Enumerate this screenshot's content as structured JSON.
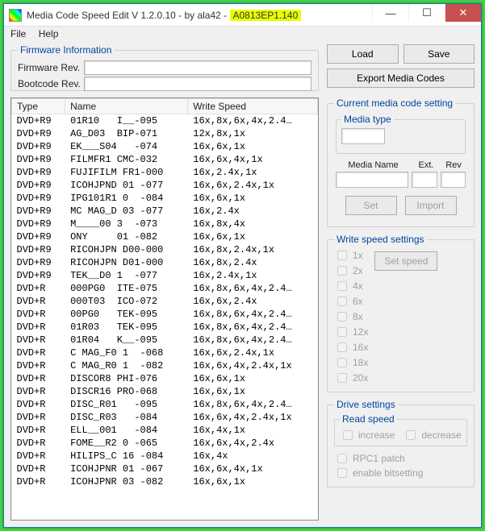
{
  "title_prefix": "Media Code Speed Edit V 1.2.0.10 - by ala42 - ",
  "title_highlight": "A0813EP1.140",
  "menu": {
    "file": "File",
    "help": "Help"
  },
  "firmware_info": {
    "legend": "Firmware Information",
    "fw_label": "Firmware Rev.",
    "fw_value": "",
    "bc_label": "Bootcode Rev.",
    "bc_value": ""
  },
  "buttons": {
    "load": "Load",
    "save": "Save",
    "export": "Export Media Codes",
    "set": "Set",
    "import": "Import",
    "set_speed": "Set speed"
  },
  "table": {
    "cols": [
      "Type",
      "Name",
      "Write Speed"
    ],
    "rows": [
      [
        "DVD+R9",
        "01R10   I__-095",
        "16x,8x,6x,4x,2.4…"
      ],
      [
        "DVD+R9",
        "AG_D03  BIP-071",
        "12x,8x,1x"
      ],
      [
        "DVD+R9",
        "EK___S04   -074",
        "16x,6x,1x"
      ],
      [
        "DVD+R9",
        "FILMFR1 CMC-032",
        "16x,6x,4x,1x"
      ],
      [
        "DVD+R9",
        "FUJIFILM FR1-000",
        "16x,2.4x,1x"
      ],
      [
        "DVD+R9",
        "ICOHJPND 01 -077",
        "16x,6x,2.4x,1x"
      ],
      [
        "DVD+R9",
        "IPG101R1 0  -084",
        "16x,6x,1x"
      ],
      [
        "DVD+R9",
        "MC MAG_D 03 -077",
        "16x,2.4x"
      ],
      [
        "DVD+R9",
        "M____00 3  -073",
        "16x,8x,4x"
      ],
      [
        "DVD+R9",
        "ONY     01 -082",
        "16x,6x,1x"
      ],
      [
        "DVD+R9",
        "RICOHJPN D00-000",
        "16x,8x,2.4x,1x"
      ],
      [
        "DVD+R9",
        "RICOHJPN D01-000",
        "16x,8x,2.4x"
      ],
      [
        "DVD+R9",
        "TEK__D0 1  -077",
        "16x,2.4x,1x"
      ],
      [
        "DVD+R",
        "000PG0  ITE-075",
        "16x,8x,6x,4x,2.4…"
      ],
      [
        "DVD+R",
        "000T03  ICO-072",
        "16x,6x,2.4x"
      ],
      [
        "DVD+R",
        "00PG0   TEK-095",
        "16x,8x,6x,4x,2.4…"
      ],
      [
        "DVD+R",
        "01R03   TEK-095",
        "16x,8x,6x,4x,2.4…"
      ],
      [
        "DVD+R",
        "01R04   K__-095",
        "16x,8x,6x,4x,2.4…"
      ],
      [
        "DVD+R",
        "C MAG_F0 1  -068",
        "16x,6x,2.4x,1x"
      ],
      [
        "DVD+R",
        "C MAG_R0 1  -082",
        "16x,6x,4x,2.4x,1x"
      ],
      [
        "DVD+R",
        "DISCOR8 PHI-076",
        "16x,6x,1x"
      ],
      [
        "DVD+R",
        "DISCR16 PRO-068",
        "16x,6x,1x"
      ],
      [
        "DVD+R",
        "DISC_R01   -095",
        "16x,8x,6x,4x,2.4…"
      ],
      [
        "DVD+R",
        "DISC_R03   -084",
        "16x,6x,4x,2.4x,1x"
      ],
      [
        "DVD+R",
        "ELL__001   -084",
        "16x,4x,1x"
      ],
      [
        "DVD+R",
        "FOME__R2 0 -065",
        "16x,6x,4x,2.4x"
      ],
      [
        "DVD+R",
        "HILIPS_C 16 -084",
        "16x,4x"
      ],
      [
        "DVD+R",
        "ICOHJPNR 01 -067",
        "16x,6x,4x,1x"
      ],
      [
        "DVD+R",
        "ICOHJPNR 03 -082",
        "16x,6x,1x"
      ]
    ]
  },
  "current": {
    "legend": "Current media code setting",
    "media_type": "Media type",
    "media_name": "Media Name",
    "ext": "Ext.",
    "rev": "Rev"
  },
  "wss": {
    "legend": "Write speed settings",
    "speeds": [
      "1x",
      "2x",
      "4x",
      "6x",
      "8x",
      "12x",
      "16x",
      "18x",
      "20x"
    ]
  },
  "drive": {
    "legend": "Drive settings",
    "read_speed": "Read speed",
    "increase": "increase",
    "decrease": "decrease",
    "rpc1": "RPC1 patch",
    "bitsetting": "enable bitsetting"
  },
  "winbtns": {
    "min": "—",
    "max": "☐",
    "close": "✕"
  }
}
